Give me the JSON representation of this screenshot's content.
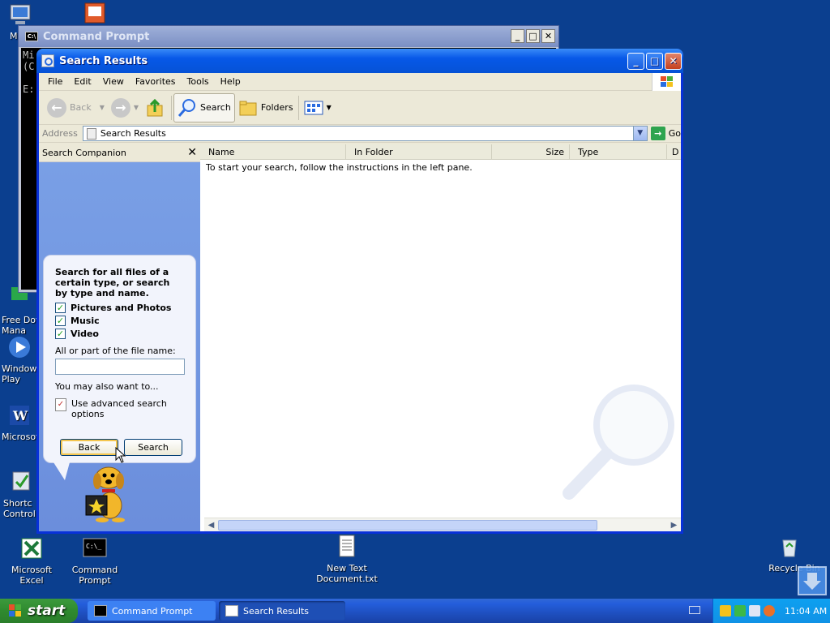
{
  "desktop": {
    "icons": [
      {
        "label": "My",
        "name": "my-computer"
      },
      {
        "label": "Free Dov Mana",
        "name": "free-download-manager"
      },
      {
        "label": "Windows Play",
        "name": "windows-media-player"
      },
      {
        "label": "Microsof",
        "name": "microsoft-word"
      },
      {
        "label": "Shortc Control",
        "name": "control-panel-shortcut"
      },
      {
        "label": "Microsoft Excel",
        "name": "microsoft-excel"
      },
      {
        "label": "Command Prompt",
        "name": "command-prompt"
      },
      {
        "label": "New Text Document.txt",
        "name": "new-text-document"
      },
      {
        "label": "Recycle Bin",
        "name": "recycle-bin"
      }
    ]
  },
  "cmd_window": {
    "title": "Command Prompt",
    "lines": [
      "Mi",
      "(C",
      "",
      "E:"
    ]
  },
  "search_window": {
    "title": "Search Results",
    "menu": [
      "File",
      "Edit",
      "View",
      "Favorites",
      "Tools",
      "Help"
    ],
    "toolbar": {
      "back": "Back",
      "search": "Search",
      "folders": "Folders"
    },
    "address": {
      "label": "Address",
      "value": "Search Results",
      "go": "Go"
    },
    "left_pane": {
      "title": "Search Companion",
      "intro": "Search for all files of a certain type, or search by type and name.",
      "checkboxes": [
        {
          "label": "Pictures and Photos",
          "checked": true
        },
        {
          "label": "Music",
          "checked": true
        },
        {
          "label": "Video",
          "checked": true
        }
      ],
      "filename_label": "All or part of the file name:",
      "filename_value": "",
      "also": "You may also want to...",
      "advanced": "Use advanced search options",
      "back_button": "Back",
      "search_button": "Search"
    },
    "columns": [
      "Name",
      "In Folder",
      "Size",
      "Type",
      "D"
    ],
    "empty_message": "To start your search, follow the instructions in the left pane."
  },
  "taskbar": {
    "start": "start",
    "tasks": [
      {
        "label": "Command Prompt",
        "active": false
      },
      {
        "label": "Search Results",
        "active": true
      }
    ],
    "clock": "11:04 AM"
  },
  "colors": {
    "desktop": "#0b3f8f",
    "titlebar": "#0758e8",
    "taskbar": "#245edb",
    "start": "#2f8a2f"
  }
}
